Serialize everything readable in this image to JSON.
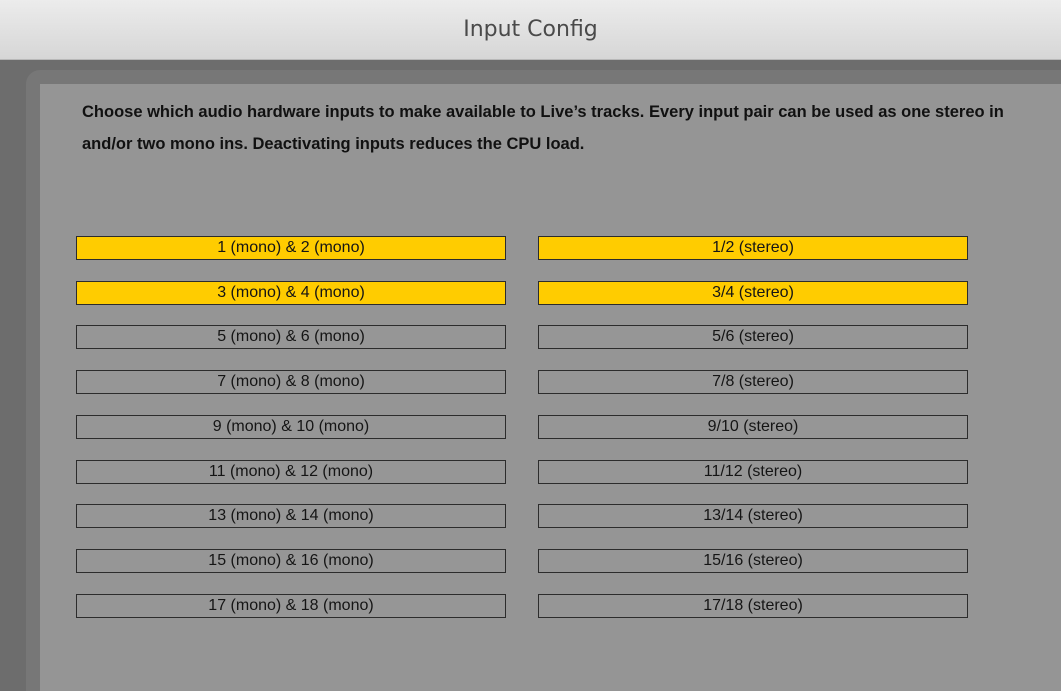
{
  "window": {
    "title": "Input Config"
  },
  "instructions": "Choose which audio hardware inputs to make available to Live’s tracks. Every input pair can be used as one stereo in and/or two mono ins.  Deactivating inputs reduces the CPU load.",
  "colors": {
    "active": "#ffcc00",
    "inactive": "#969696",
    "panel": "#959595",
    "frame": "#6d6d6d"
  },
  "inputs": [
    {
      "mono_label": "1 (mono) & 2 (mono)",
      "mono_active": true,
      "stereo_label": "1/2 (stereo)",
      "stereo_active": true
    },
    {
      "mono_label": "3 (mono) & 4 (mono)",
      "mono_active": true,
      "stereo_label": "3/4 (stereo)",
      "stereo_active": true
    },
    {
      "mono_label": "5 (mono) & 6 (mono)",
      "mono_active": false,
      "stereo_label": "5/6 (stereo)",
      "stereo_active": false
    },
    {
      "mono_label": "7 (mono) & 8 (mono)",
      "mono_active": false,
      "stereo_label": "7/8 (stereo)",
      "stereo_active": false
    },
    {
      "mono_label": "9 (mono) & 10 (mono)",
      "mono_active": false,
      "stereo_label": "9/10 (stereo)",
      "stereo_active": false
    },
    {
      "mono_label": "11 (mono) & 12 (mono)",
      "mono_active": false,
      "stereo_label": "11/12 (stereo)",
      "stereo_active": false
    },
    {
      "mono_label": "13 (mono) & 14 (mono)",
      "mono_active": false,
      "stereo_label": "13/14 (stereo)",
      "stereo_active": false
    },
    {
      "mono_label": "15 (mono) & 16 (mono)",
      "mono_active": false,
      "stereo_label": "15/16 (stereo)",
      "stereo_active": false
    },
    {
      "mono_label": "17 (mono) & 18 (mono)",
      "mono_active": false,
      "stereo_label": "17/18 (stereo)",
      "stereo_active": false
    }
  ]
}
